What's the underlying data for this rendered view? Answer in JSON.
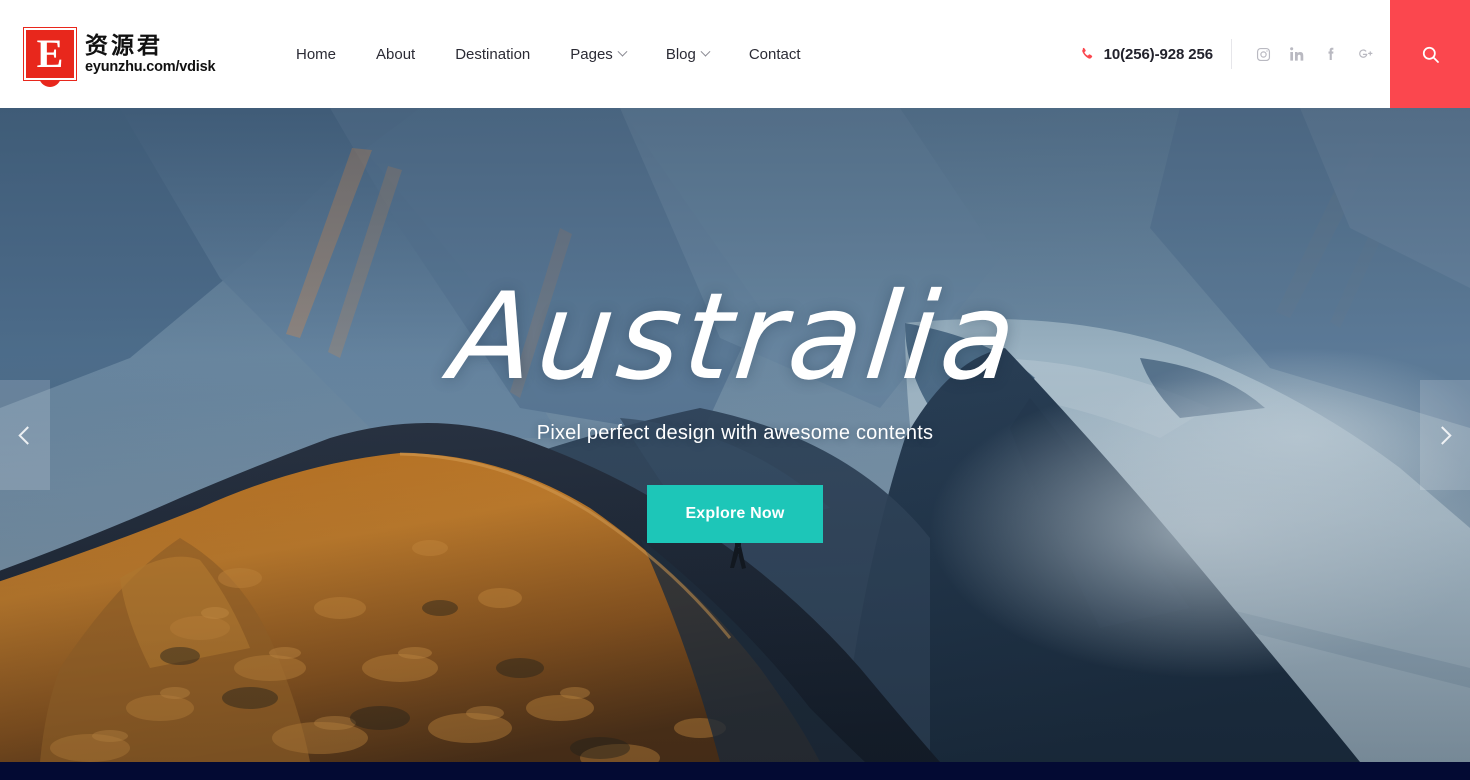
{
  "header": {
    "logo": {
      "mark_letter": "E",
      "brand_cn": "资源君",
      "brand_url": "eyunzhu.com/vdisk",
      "mark_color": "#E8271C"
    },
    "nav_items": [
      {
        "label": "Home",
        "has_dropdown": false
      },
      {
        "label": "About",
        "has_dropdown": false
      },
      {
        "label": "Destination",
        "has_dropdown": false
      },
      {
        "label": "Pages",
        "has_dropdown": true
      },
      {
        "label": "Blog",
        "has_dropdown": true
      },
      {
        "label": "Contact",
        "has_dropdown": false
      }
    ],
    "phone": {
      "icon": "phone-icon",
      "number": "10(256)-928 256",
      "icon_color": "#FB474E"
    },
    "socials": [
      {
        "name": "instagram-icon",
        "label": "Instagram"
      },
      {
        "name": "linkedin-icon",
        "label": "LinkedIn"
      },
      {
        "name": "facebook-icon",
        "label": "Facebook"
      },
      {
        "name": "googleplus-icon",
        "label": "Google Plus"
      }
    ],
    "search": {
      "icon": "search-icon",
      "label": "Search",
      "bg_color": "#FB474E"
    }
  },
  "hero": {
    "title": "Australia",
    "subtitle": "Pixel perfect design with awesome contents",
    "cta_label": "Explore Now",
    "cta_color": "#1DC6B8",
    "prev_label": "Previous slide",
    "next_label": "Next slide",
    "prev_icon": "chevron-left-icon",
    "next_icon": "chevron-right-icon",
    "image_alt": "Person standing on a golden mountain ridge overlooking a blue fjord"
  },
  "footer": {
    "bg_color": "#030a33"
  }
}
